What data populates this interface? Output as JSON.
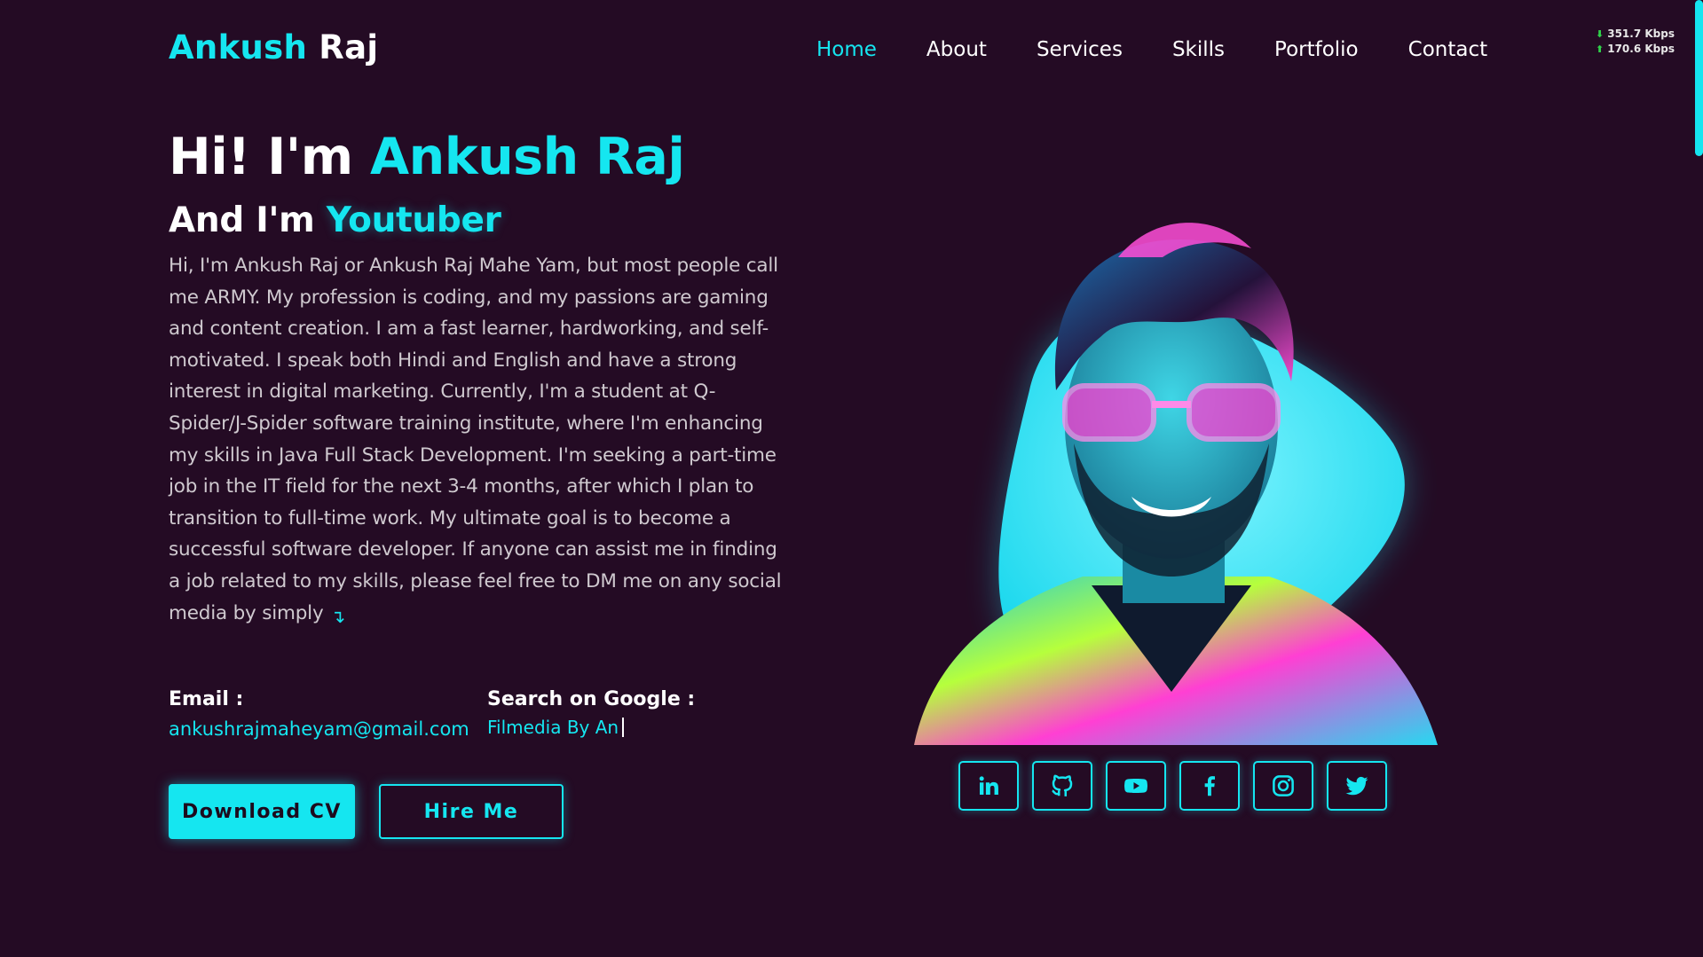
{
  "brand": {
    "first": "Ankush",
    "last": "Raj",
    "accent_color": "#15e6f0",
    "background_color": "#240b24"
  },
  "nav": {
    "items": [
      {
        "label": "Home",
        "active": true
      },
      {
        "label": "About",
        "active": false
      },
      {
        "label": "Services",
        "active": false
      },
      {
        "label": "Skills",
        "active": false
      },
      {
        "label": "Portfolio",
        "active": false
      },
      {
        "label": "Contact",
        "active": false
      }
    ]
  },
  "network": {
    "download": "351.7 Kbps",
    "upload": "170.6 Kbps"
  },
  "hero": {
    "greeting": "Hi! I'm",
    "name": "Ankush Raj",
    "role_prefix": "And I'm",
    "role": "Youtuber",
    "bio": "Hi, I'm Ankush Raj or Ankush Raj Mahe Yam, but most people call me ARMY. My profession is coding, and my passions are gaming and content creation. I am a fast learner, hardworking, and self-motivated. I speak both Hindi and English and have a strong interest in digital marketing. Currently, I'm a student at Q-Spider/J-Spider software training institute, where I'm enhancing my skills in Java Full Stack Development. I'm seeking a part-time job in the IT field for the next 3-4 months, after which I plan to transition to full-time work. My ultimate goal is to become a successful software developer. If anyone can assist me in finding a job related to my skills, please feel free to DM me on any social media by simply",
    "bio_more_icon": "arrow-down-right-icon"
  },
  "contact": {
    "email_label": "Email :",
    "email_value": "ankushrajmaheyam@gmail.com",
    "google_label": "Search on Google :",
    "google_value": "Filmedia By An"
  },
  "buttons": {
    "download_cv": "Download CV",
    "hire_me": "Hire Me"
  },
  "socials": [
    {
      "name": "linkedin-icon"
    },
    {
      "name": "github-icon"
    },
    {
      "name": "youtube-icon"
    },
    {
      "name": "facebook-icon"
    },
    {
      "name": "instagram-icon"
    },
    {
      "name": "twitter-icon"
    }
  ]
}
